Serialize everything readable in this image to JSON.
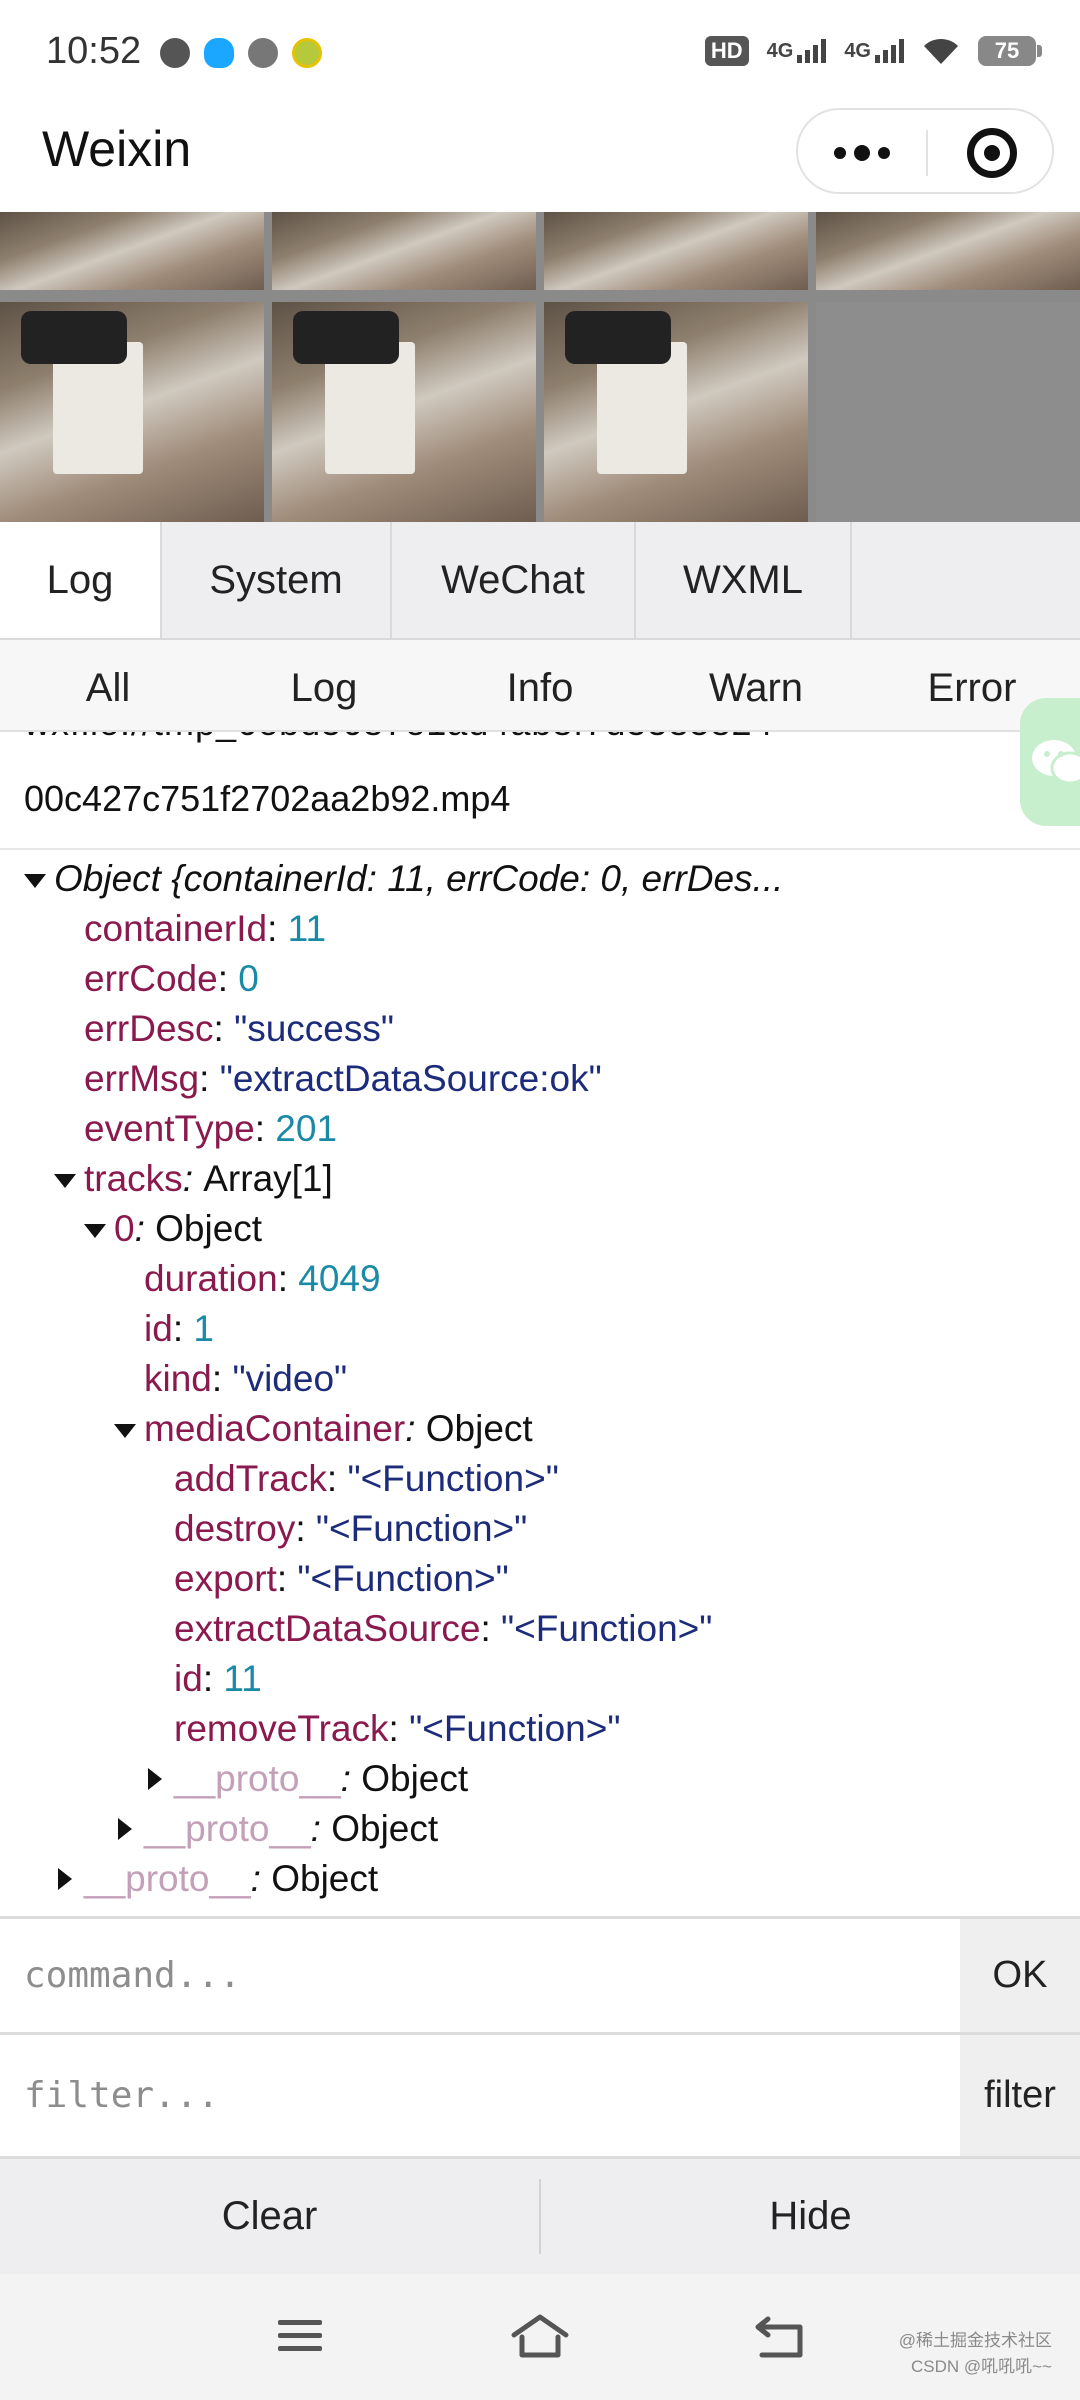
{
  "status_bar": {
    "time": "10:52",
    "hd_label": "HD",
    "network_1": "4G",
    "network_2": "4G",
    "battery": "75"
  },
  "title_bar": {
    "title": "Weixin",
    "more_icon": "more-dots-icon",
    "close_icon": "close-target-icon"
  },
  "panel_tabs": [
    "Log",
    "System",
    "WeChat",
    "WXML"
  ],
  "level_tabs": [
    "All",
    "Log",
    "Info",
    "Warn",
    "Error"
  ],
  "log": {
    "file_path_end": "00c427c751f2702aa2b92.mp4",
    "object_summary": "Object {containerId: 11, errCode: 0, errDes...",
    "fields": {
      "containerId": {
        "key": "containerId",
        "value": "11"
      },
      "errCode": {
        "key": "errCode",
        "value": "0"
      },
      "errDesc": {
        "key": "errDesc",
        "value": "\"success\""
      },
      "errMsg": {
        "key": "errMsg",
        "value": "\"extractDataSource:ok\""
      },
      "eventType": {
        "key": "eventType",
        "value": "201"
      },
      "tracks": {
        "key": "tracks",
        "value": "Array[1]"
      },
      "track0": {
        "key": "0",
        "value": "Object"
      },
      "duration": {
        "key": "duration",
        "value": "4049"
      },
      "id": {
        "key": "id",
        "value": "1"
      },
      "kind": {
        "key": "kind",
        "value": "\"video\""
      },
      "mediaContainer": {
        "key": "mediaContainer",
        "value": "Object"
      },
      "addTrack": {
        "key": "addTrack",
        "value": "\"<Function>\""
      },
      "destroy": {
        "key": "destroy",
        "value": "\"<Function>\""
      },
      "export": {
        "key": "export",
        "value": "\"<Function>\""
      },
      "extractDataSource": {
        "key": "extractDataSource",
        "value": "\"<Function>\""
      },
      "mcId": {
        "key": "id",
        "value": "11"
      },
      "removeTrack": {
        "key": "removeTrack",
        "value": "\"<Function>\""
      },
      "proto": {
        "key": "__proto__",
        "value": "Object"
      }
    }
  },
  "command": {
    "placeholder": "command...",
    "button": "OK"
  },
  "filter": {
    "placeholder": "filter...",
    "button": "filter"
  },
  "actions": {
    "clear": "Clear",
    "hide": "Hide"
  },
  "watermark": {
    "line1": "@稀土掘金技术社区",
    "line2": "CSDN @吼吼吼~~"
  }
}
